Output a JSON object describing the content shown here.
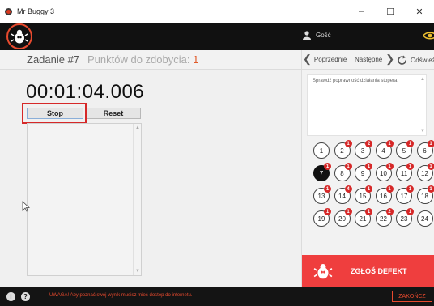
{
  "window": {
    "title": "Mr Buggy 3",
    "controls": [
      "–",
      "☐",
      "✕"
    ]
  },
  "header": {
    "user_name": "Gość"
  },
  "task": {
    "title": "Zadanie #7",
    "points_label": "Punktów do zdobycia:",
    "points_value": "1",
    "prev_label": "Poprzednie",
    "next_label": "Następne",
    "refresh_label": "Odśwież"
  },
  "stopwatch": {
    "time": "00:01:04.006",
    "stop_label": "Stop",
    "reset_label": "Reset"
  },
  "description": {
    "text": "Sprawdź poprawność działania stopera."
  },
  "tests": [
    {
      "n": "1",
      "badge": ""
    },
    {
      "n": "2",
      "badge": "1"
    },
    {
      "n": "3",
      "badge": "2"
    },
    {
      "n": "4",
      "badge": "1"
    },
    {
      "n": "5",
      "badge": "1"
    },
    {
      "n": "6",
      "badge": "1"
    },
    {
      "n": "7",
      "badge": "1",
      "active": true
    },
    {
      "n": "8",
      "badge": "1"
    },
    {
      "n": "9",
      "badge": "1"
    },
    {
      "n": "10",
      "badge": "1"
    },
    {
      "n": "11",
      "badge": "1"
    },
    {
      "n": "12",
      "badge": "1"
    },
    {
      "n": "13",
      "badge": "1"
    },
    {
      "n": "14",
      "badge": "4"
    },
    {
      "n": "15",
      "badge": "1"
    },
    {
      "n": "16",
      "badge": "1"
    },
    {
      "n": "17",
      "badge": "1"
    },
    {
      "n": "18",
      "badge": "1"
    },
    {
      "n": "19",
      "badge": "1"
    },
    {
      "n": "20",
      "badge": "1"
    },
    {
      "n": "21",
      "badge": "1"
    },
    {
      "n": "22",
      "badge": "2"
    },
    {
      "n": "23",
      "badge": "1"
    },
    {
      "n": "24",
      "badge": ""
    }
  ],
  "report": {
    "label": "ZGŁOŚ DEFEKT"
  },
  "footer": {
    "warning": "UWAGA! Aby poznać swój wynik musisz mieć dostęp do internetu.",
    "finish_label": "ZAKOŃCZ"
  },
  "colors": {
    "accent": "#ef3e3e",
    "header_bg": "#111111",
    "highlight": "#d62828"
  }
}
